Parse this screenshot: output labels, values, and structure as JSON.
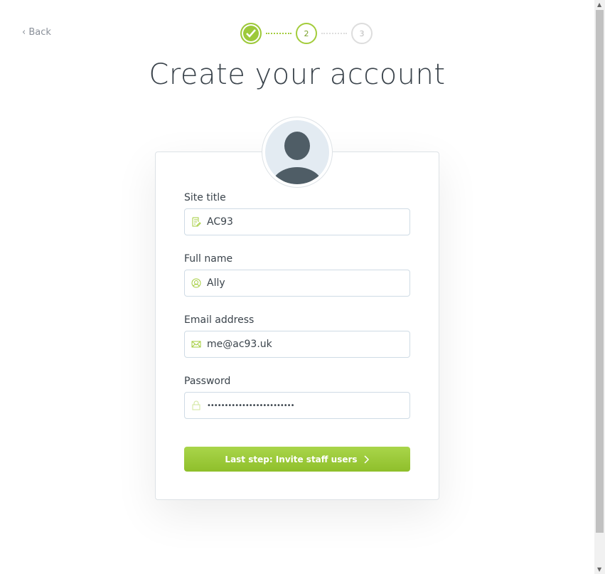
{
  "nav": {
    "back_label": "Back"
  },
  "steps": [
    {
      "label": "1",
      "state": "done"
    },
    {
      "label": "2",
      "state": "current"
    },
    {
      "label": "3",
      "state": "todo"
    }
  ],
  "title": "Create your account",
  "form": {
    "site_title": {
      "label": "Site title",
      "value": "AC93",
      "icon": "edit-document-icon"
    },
    "full_name": {
      "label": "Full name",
      "value": "Ally",
      "icon": "user-icon"
    },
    "email": {
      "label": "Email address",
      "value": "me@ac93.uk",
      "icon": "envelope-icon"
    },
    "password": {
      "label": "Password",
      "value": "•••••••••••••••••••••••••",
      "icon": "lock-icon"
    },
    "submit_label": "Last step: Invite staff users"
  },
  "colors": {
    "accent": "#9dc93a",
    "text": "#3a434b"
  }
}
